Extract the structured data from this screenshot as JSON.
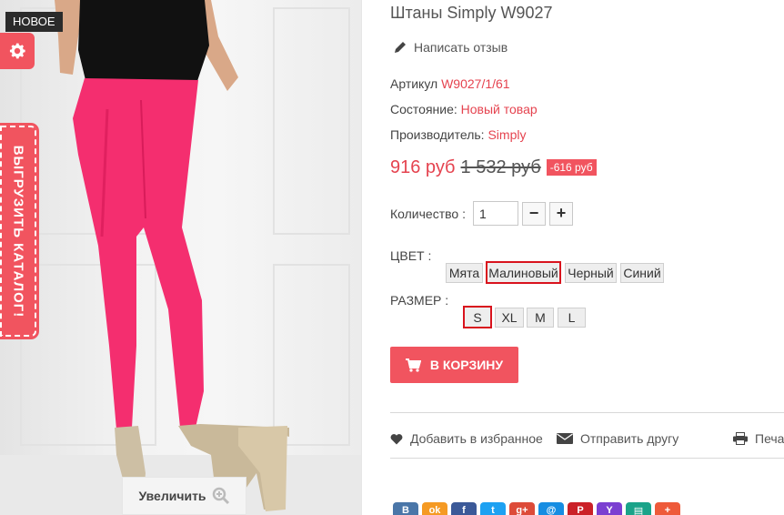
{
  "image": {
    "badge": "НОВОЕ",
    "catalog_tab": "ВЫГРУЗИТЬ КАТАЛОГ!",
    "zoom_label": "Увеличить"
  },
  "product": {
    "title": "Штаны Simply W9027",
    "review_link": "Написать отзыв",
    "sku_label": "Артикул",
    "sku_value": "W9027/1/61",
    "condition_label": "Состояние:",
    "condition_value": "Новый товар",
    "maker_label": "Производитель:",
    "maker_value": "Simply",
    "price_new": "916 руб",
    "price_old": "1 532 руб",
    "discount": "-616 руб"
  },
  "quantity": {
    "label": "Количество :",
    "value": "1",
    "minus": "−",
    "plus": "+"
  },
  "color": {
    "label": "ЦВЕТ :",
    "options": [
      "Мята",
      "Малиновый",
      "Черный",
      "Синий"
    ],
    "selected": "Малиновый"
  },
  "size": {
    "label": "РАЗМЕР :",
    "options": [
      "S",
      "XL",
      "M",
      "L"
    ],
    "selected": "S"
  },
  "cart_button": "В КОРЗИНУ",
  "actions": {
    "wishlist": "Добавить в избранное",
    "send_friend": "Отправить другу",
    "print": "Печать"
  },
  "colors": {
    "accent": "#f1545f",
    "price": "#e5434f",
    "selected_border": "#d9131d"
  },
  "social_icons": [
    {
      "name": "vk-icon",
      "glyph": "B",
      "color": "#4a76a8"
    },
    {
      "name": "odnoklassniki-icon",
      "glyph": "ok",
      "color": "#f59a23"
    },
    {
      "name": "facebook-icon",
      "glyph": "f",
      "color": "#3b5998"
    },
    {
      "name": "twitter-icon",
      "glyph": "t",
      "color": "#1da1f2"
    },
    {
      "name": "google-plus-icon",
      "glyph": "g+",
      "color": "#dd4b39"
    },
    {
      "name": "mailru-icon",
      "glyph": "@",
      "color": "#168de2"
    },
    {
      "name": "pinterest-icon",
      "glyph": "P",
      "color": "#cb2027"
    },
    {
      "name": "yahoo-icon",
      "glyph": "Y",
      "color": "#7b3fd1"
    },
    {
      "name": "print-share-icon",
      "glyph": "▤",
      "color": "#1aa389"
    },
    {
      "name": "more-share-icon",
      "glyph": "+",
      "color": "#ee5a3a"
    }
  ]
}
